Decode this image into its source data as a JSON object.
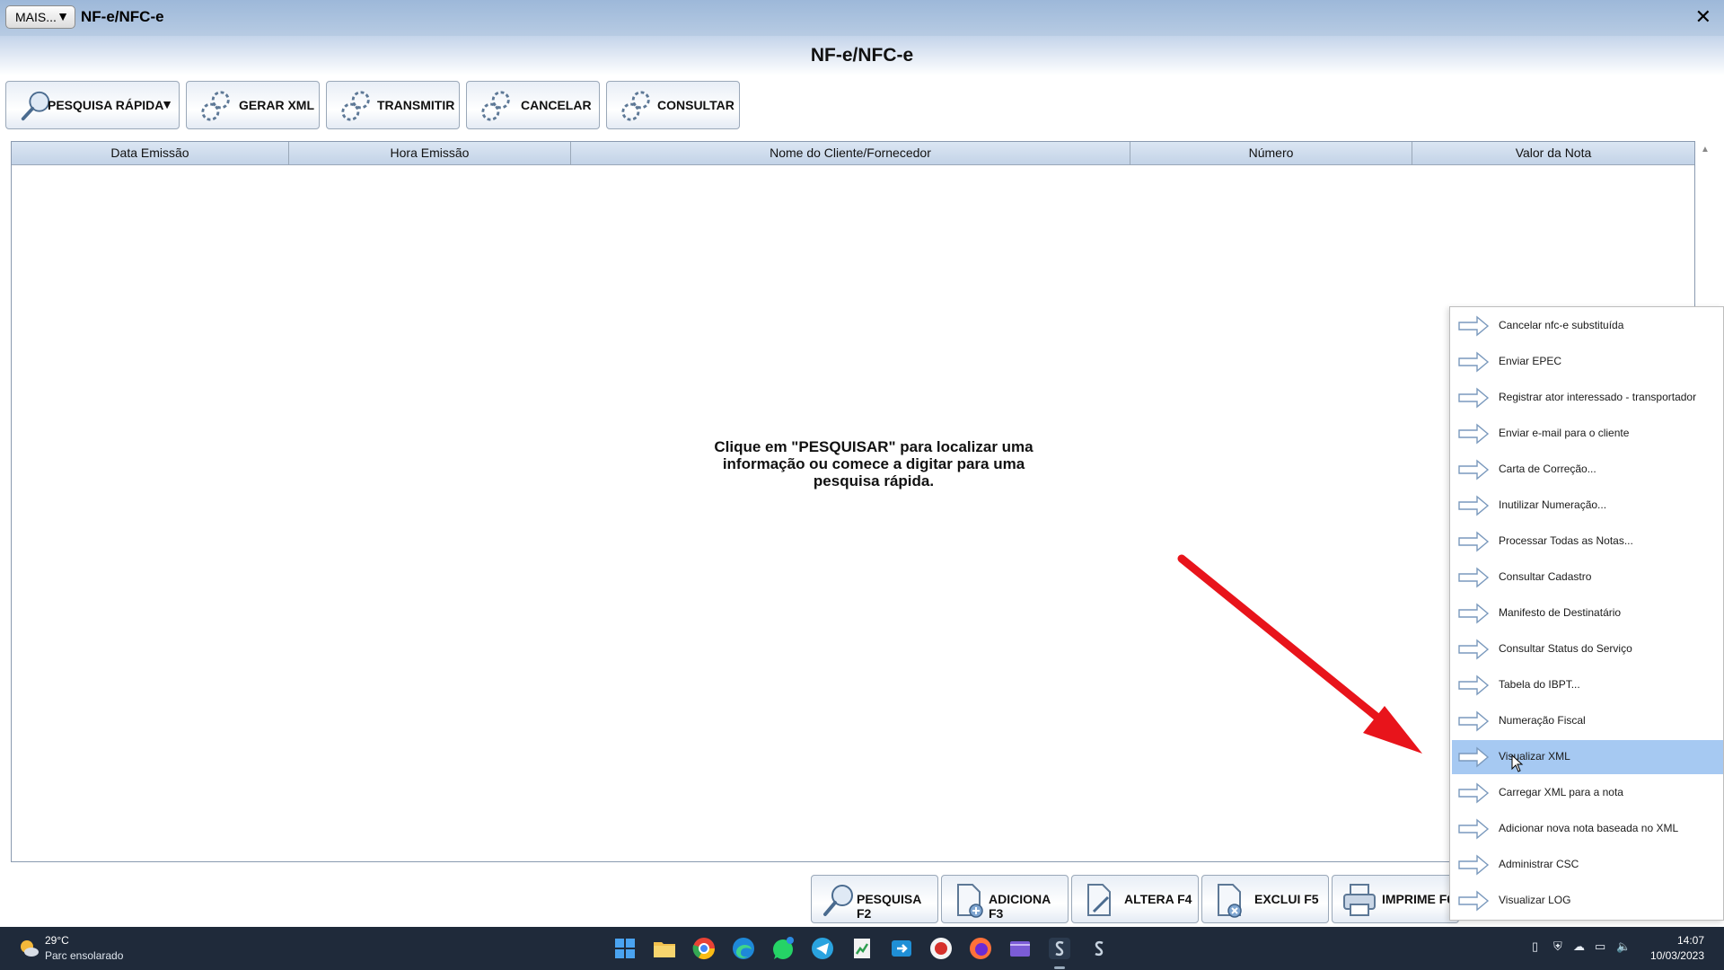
{
  "window": {
    "mais_label": "MAIS...",
    "title": "NF-e/NFC-e",
    "close_glyph": "✕"
  },
  "page_title": "NF-e/NFC-e",
  "toolbar": {
    "pesquisa_rapida": "PESQUISA RÁPIDA",
    "gerar_xml": "GERAR XML",
    "transmitir": "TRANSMITIR",
    "cancelar": "CANCELAR",
    "consultar": "CONSULTAR"
  },
  "grid": {
    "columns": [
      "Data Emissão",
      "Hora Emissão",
      "Nome do Cliente/Fornecedor",
      "Número",
      "Valor da Nota"
    ],
    "empty_message": "Clique em \"PESQUISAR\" para localizar uma informação ou comece a digitar para uma pesquisa rápida."
  },
  "bottom_buttons": {
    "pesquisa": "PESQUISA F2",
    "adiciona": "ADICIONA F3",
    "altera": "ALTERA F4",
    "exclui": "EXCLUI F5",
    "imprime": "IMPRIME F6"
  },
  "context_menu": {
    "highlighted_index": 12,
    "items": [
      "Cancelar nfc-e substituída",
      "Enviar EPEC",
      "Registrar ator interessado - transportador",
      "Enviar e-mail para o cliente",
      "Carta de Correção...",
      "Inutilizar Numeração...",
      "Processar Todas as Notas...",
      "Consultar Cadastro",
      "Manifesto de Destinatário",
      "Consultar Status do Serviço",
      "Tabela do IBPT...",
      "Numeração Fiscal",
      "Visualizar XML",
      "Carregar XML para a nota",
      "Adicionar nova nota baseada no XML",
      "Administrar CSC",
      "Visualizar LOG"
    ]
  },
  "taskbar": {
    "weather_temp": "29°C",
    "weather_desc": "Parc ensolarado",
    "time": "14:07",
    "date": "10/03/2023"
  },
  "colors": {
    "highlight": "#a6c9f2",
    "annotation_arrow": "#e8141b",
    "taskbar": "#1f2a3a"
  }
}
